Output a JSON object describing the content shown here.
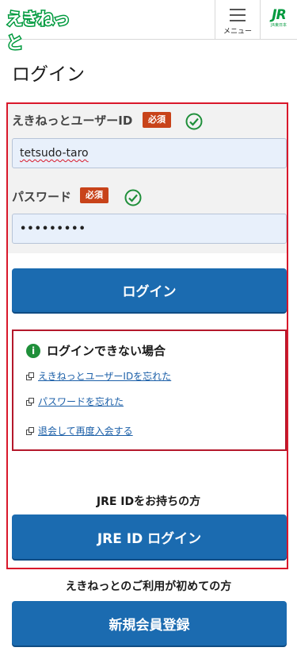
{
  "header": {
    "logo_text": "えきねっと",
    "menu_label": "メニュー",
    "jr_logo_mark": "JR",
    "jr_logo_sub": "JR東日本"
  },
  "page": {
    "title": "ログイン"
  },
  "form": {
    "user_id_label": "えきねっとユーザーID",
    "password_label": "パスワード",
    "required_badge": "必須",
    "user_id_value": "tetsudo-taro",
    "password_value": "•••••••••",
    "login_button": "ログイン"
  },
  "help": {
    "title": "ログインできない場合",
    "links": [
      "えきねっとユーザーIDを忘れた",
      "パスワードを忘れた",
      "退会して再度入会する"
    ]
  },
  "jre": {
    "caption": "JRE IDをお持ちの方",
    "button": "JRE ID ログイン"
  },
  "signup": {
    "caption": "えきねっとのご利用が初めての方",
    "button": "新規会員登録"
  },
  "colors": {
    "brand_green": "#009a3e",
    "button_blue": "#1b6bb0",
    "frame_red": "#d9182b",
    "required_orange": "#c8431a"
  }
}
